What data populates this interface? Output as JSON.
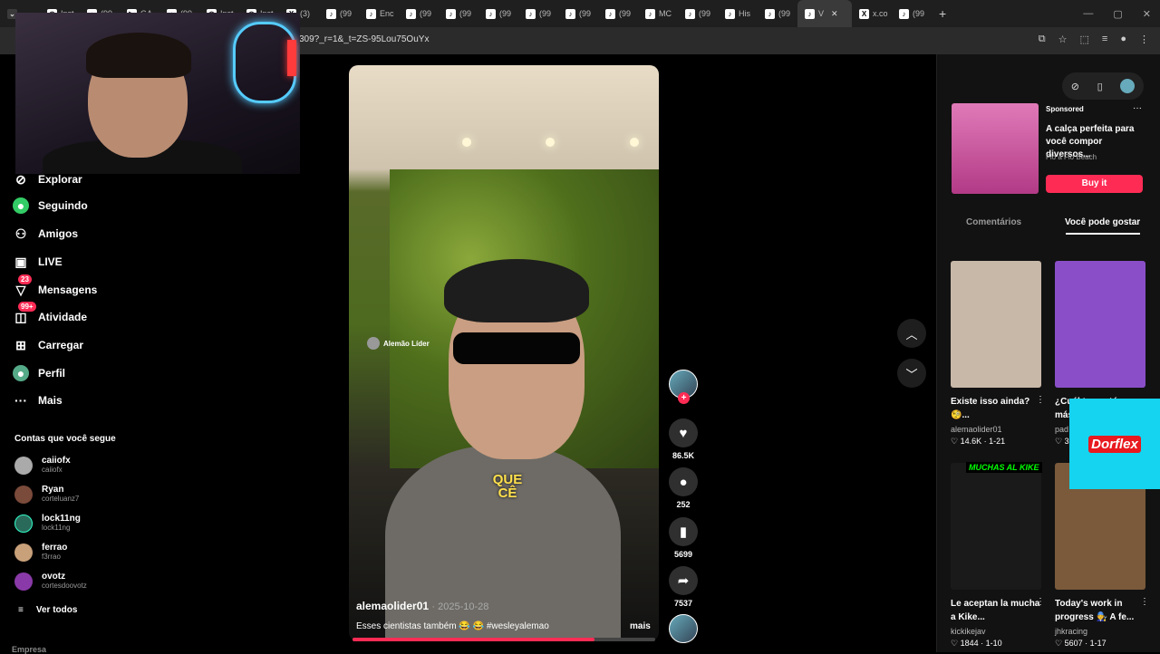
{
  "tabs": [
    {
      "label": "Inst",
      "fav": "◎"
    },
    {
      "label": "(99",
      "fav": "♪"
    },
    {
      "label": "GA",
      "fav": "▶"
    },
    {
      "label": "(99",
      "fav": "♪"
    },
    {
      "label": "Inst",
      "fav": "◎"
    },
    {
      "label": "Inst",
      "fav": "◎"
    },
    {
      "label": "(3)",
      "fav": "X"
    },
    {
      "label": "(99",
      "fav": "♪"
    },
    {
      "label": "Enc",
      "fav": "♪"
    },
    {
      "label": "(99",
      "fav": "♪"
    },
    {
      "label": "(99",
      "fav": "♪"
    },
    {
      "label": "(99",
      "fav": "♪"
    },
    {
      "label": "(99",
      "fav": "♪"
    },
    {
      "label": "(99",
      "fav": "♪"
    },
    {
      "label": "(99",
      "fav": "♪"
    },
    {
      "label": "MC",
      "fav": "♪"
    },
    {
      "label": "(99",
      "fav": "♪"
    },
    {
      "label": "His",
      "fav": "♪"
    },
    {
      "label": "(99",
      "fav": "♪"
    },
    {
      "label": "V",
      "fav": "♪",
      "active": true
    },
    {
      "label": "x.co",
      "fav": "X"
    },
    {
      "label": "(99",
      "fav": "♪"
    }
  ],
  "address": {
    "url": "309?_r=1&_t=ZS-95Lou75OuYx"
  },
  "sidebar": {
    "items": [
      {
        "label": "Explorar",
        "icon": "compass-icon"
      },
      {
        "label": "Seguindo",
        "icon": "following-icon"
      },
      {
        "label": "Amigos",
        "icon": "friends-icon"
      },
      {
        "label": "LIVE",
        "icon": "live-icon"
      },
      {
        "label": "Mensagens",
        "icon": "messages-icon",
        "badge": "23"
      },
      {
        "label": "Atividade",
        "icon": "activity-icon",
        "badge": "99+"
      },
      {
        "label": "Carregar",
        "icon": "upload-icon"
      },
      {
        "label": "Perfil",
        "icon": "profile-icon"
      },
      {
        "label": "Mais",
        "icon": "more-icon"
      }
    ],
    "following_title": "Contas que você segue",
    "accounts": [
      {
        "name": "caiiofx",
        "handle": "caiiofx"
      },
      {
        "name": "Ryan",
        "handle": "corteluanz7"
      },
      {
        "name": "lock11ng",
        "handle": "lock11ng"
      },
      {
        "name": "ferrao",
        "handle": "f3rrao"
      },
      {
        "name": "ovotz",
        "handle": "cortesdoovotz"
      }
    ],
    "see_all": "Ver todos",
    "footer": "Empresa"
  },
  "video": {
    "author": "alemaolider01",
    "date": "· 2025-10-28",
    "description": "Esses cientistas também 😂 😂 #wesleyalemao",
    "more": "mais",
    "watermark": "Alemão Líder",
    "caption_line1": "QUE",
    "caption_line2": "CÊ",
    "progress": 0.8
  },
  "actions": {
    "likes": "86.5K",
    "comments": "252",
    "saves": "5699",
    "shares": "7537"
  },
  "ad": {
    "sponsored": "Sponsored",
    "title": "A calça perfeita para você compor diversos...",
    "brand": "Flo a Flo Beach",
    "button": "Buy it"
  },
  "right_tabs": {
    "comments": "Comentários",
    "you_may_like": "Você pode gostar"
  },
  "cards": [
    {
      "title": "Existe isso ainda? 🧐...",
      "user": "alemaolider01",
      "likes": "♡ 14.6K",
      "date": "1-21",
      "color": "#c8b8a8"
    },
    {
      "title": "¿Cuál te gustó más?...",
      "user": "pad",
      "likes": "♡ 3",
      "date": "",
      "color": "#8a4fc8"
    },
    {
      "title": "Le aceptan la mucha a Kike...",
      "user": "kickikejav",
      "likes": "♡ 1844",
      "date": "1-10",
      "color": "#222"
    },
    {
      "title": "Today's work in progress 🧑‍🔧 A fe...",
      "user": "jhkracing",
      "likes": "♡ 5607",
      "date": "1-17",
      "color": "#7a5a3a"
    }
  ],
  "overlays": {
    "dorflex": "Dorflex",
    "muchas": "MUCHAS AL KIKE"
  }
}
